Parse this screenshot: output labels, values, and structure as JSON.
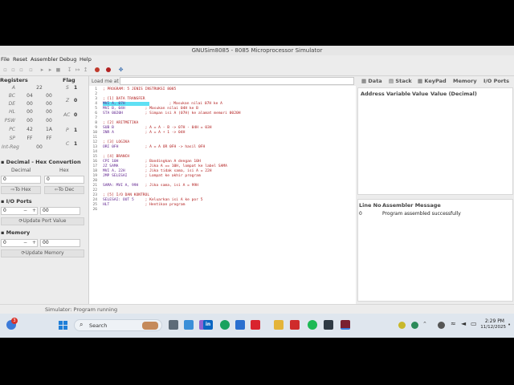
{
  "window": {
    "title": "GNUSim8085 - 8085 Microprocessor Simulator"
  },
  "menu": [
    "File",
    "Reset",
    "Assembler",
    "Debug",
    "Help"
  ],
  "registers": {
    "title": "Registers",
    "rows": [
      {
        "name": "A",
        "v1": "22",
        "v2": ""
      },
      {
        "name": "BC",
        "v1": "04",
        "v2": "00"
      },
      {
        "name": "DE",
        "v1": "00",
        "v2": "00"
      },
      {
        "name": "HL",
        "v1": "00",
        "v2": "00"
      },
      {
        "name": "PSW",
        "v1": "00",
        "v2": "00"
      },
      {
        "name": "PC",
        "v1": "42",
        "v2": "1A"
      },
      {
        "name": "SP",
        "v1": "FF",
        "v2": "FF"
      },
      {
        "name": "Int-Reg",
        "v1": "00",
        "v2": ""
      }
    ]
  },
  "flags": {
    "title": "Flag",
    "rows": [
      {
        "name": "S",
        "value": "1"
      },
      {
        "name": "Z",
        "value": "0"
      },
      {
        "name": "AC",
        "value": "0"
      },
      {
        "name": "P",
        "value": "1"
      },
      {
        "name": "C",
        "value": "1"
      }
    ]
  },
  "converter": {
    "title": "Decimal - Hex Convertion",
    "decimal_label": "Decimal",
    "hex_label": "Hex",
    "decimal_value": "0",
    "hex_value": "0",
    "to_hex": "To Hex",
    "to_dec": "To Dec"
  },
  "io_ports": {
    "title": "I/O Ports",
    "port": "0",
    "minus": "−",
    "plus": "+",
    "value": "00",
    "update": "Update Port Value"
  },
  "memory": {
    "title": "Memory",
    "addr": "0",
    "minus": "−",
    "plus": "+",
    "value": "00",
    "update": "Update Memory"
  },
  "editor": {
    "load_label": "Load me at",
    "lines": [
      {
        "n": "1",
        "parts": [
          {
            "t": "; PROGRAM: 5 JENIS INSTRUKSI 8085",
            "c": "c"
          }
        ]
      },
      {
        "n": "2",
        "parts": []
      },
      {
        "n": "3",
        "parts": [
          {
            "t": "; [1] DATA TRANSFER",
            "c": "c"
          }
        ]
      },
      {
        "n": "4",
        "hl": true,
        "parts": [
          {
            "t": "MVI A, 07H",
            "c": "k"
          },
          {
            "t": "         ; Masukan nilai 07H ke A",
            "c": "c"
          }
        ]
      },
      {
        "n": "5",
        "parts": [
          {
            "t": "MVI B, 04H",
            "c": "k"
          },
          {
            "t": "         ; Masukan nilai 04H ke B",
            "c": "c"
          }
        ]
      },
      {
        "n": "6",
        "parts": [
          {
            "t": "STA 0020H",
            "c": "k"
          },
          {
            "t": "          ; Simpan isi A (07H) ke alamat memori 0020H",
            "c": "c"
          }
        ]
      },
      {
        "n": "7",
        "parts": []
      },
      {
        "n": "8",
        "parts": [
          {
            "t": "; [2] ARITMETIKA",
            "c": "c"
          }
        ]
      },
      {
        "n": "9",
        "parts": [
          {
            "t": "SUB B",
            "c": "k"
          },
          {
            "t": "              ; A = A - B -> 07H - 04H = 03H",
            "c": "c"
          }
        ]
      },
      {
        "n": "10",
        "parts": [
          {
            "t": "INR A",
            "c": "k"
          },
          {
            "t": "              ; A = A + 1 -> 04H",
            "c": "c"
          }
        ]
      },
      {
        "n": "11",
        "parts": []
      },
      {
        "n": "12",
        "parts": [
          {
            "t": "; [3] LOGIKA",
            "c": "c"
          }
        ]
      },
      {
        "n": "13",
        "parts": [
          {
            "t": "ORI 0FH",
            "c": "k"
          },
          {
            "t": "            ; A = A OR 0FH -> hasil 0FH",
            "c": "c"
          }
        ]
      },
      {
        "n": "14",
        "parts": []
      },
      {
        "n": "15",
        "parts": [
          {
            "t": "; [4] BRANCH",
            "c": "c"
          }
        ]
      },
      {
        "n": "16",
        "parts": [
          {
            "t": "CPI 10H",
            "c": "k"
          },
          {
            "t": "            ; Bandingkan A dengan 10H",
            "c": "c"
          }
        ]
      },
      {
        "n": "17",
        "parts": [
          {
            "t": "JZ SAMA",
            "c": "k"
          },
          {
            "t": "            ; Jika A == 10H, lompat ke label SAMA",
            "c": "c"
          }
        ]
      },
      {
        "n": "18",
        "parts": [
          {
            "t": "MVI A, 22H",
            "c": "k"
          },
          {
            "t": "         ; Jika tidak sama, isi A = 22H",
            "c": "c"
          }
        ]
      },
      {
        "n": "19",
        "parts": [
          {
            "t": "JMP SELESAI",
            "c": "k"
          },
          {
            "t": "        ; Lompat ke akhir program",
            "c": "c"
          }
        ]
      },
      {
        "n": "20",
        "parts": []
      },
      {
        "n": "21",
        "parts": [
          {
            "t": "SAMA: MVI A, 99H",
            "c": "k"
          },
          {
            "t": "   ; Jika sama, isi A = 99H",
            "c": "c"
          }
        ]
      },
      {
        "n": "22",
        "parts": []
      },
      {
        "n": "23",
        "parts": [
          {
            "t": "; [5] I/O DAN KONTROL",
            "c": "c"
          }
        ]
      },
      {
        "n": "24",
        "parts": [
          {
            "t": "SELESAI: OUT 5",
            "c": "k"
          },
          {
            "t": "     ; Keluarkan isi A ke por 5",
            "c": "c"
          }
        ]
      },
      {
        "n": "25",
        "parts": [
          {
            "t": "HLT",
            "c": "k"
          },
          {
            "t": "                ; Hentikan program",
            "c": "c"
          }
        ]
      },
      {
        "n": "26",
        "parts": []
      }
    ]
  },
  "right_tabs": [
    "Data",
    "Stack",
    "KeyPad",
    "Memory",
    "I/O Ports"
  ],
  "data_table": {
    "headers": [
      "Address",
      "Variable",
      "Value",
      "Value (Decimal)"
    ]
  },
  "assembler_msgs": {
    "headers": [
      "Line No",
      "Assembler Message"
    ],
    "rows": [
      {
        "line": "0",
        "msg": "Program assembled successfully"
      }
    ]
  },
  "status": "Simulator: Program running",
  "taskbar": {
    "search_placeholder": "Search",
    "clock_time": "2:29 PM",
    "clock_date": "11/12/2025",
    "notif_count": "3"
  }
}
